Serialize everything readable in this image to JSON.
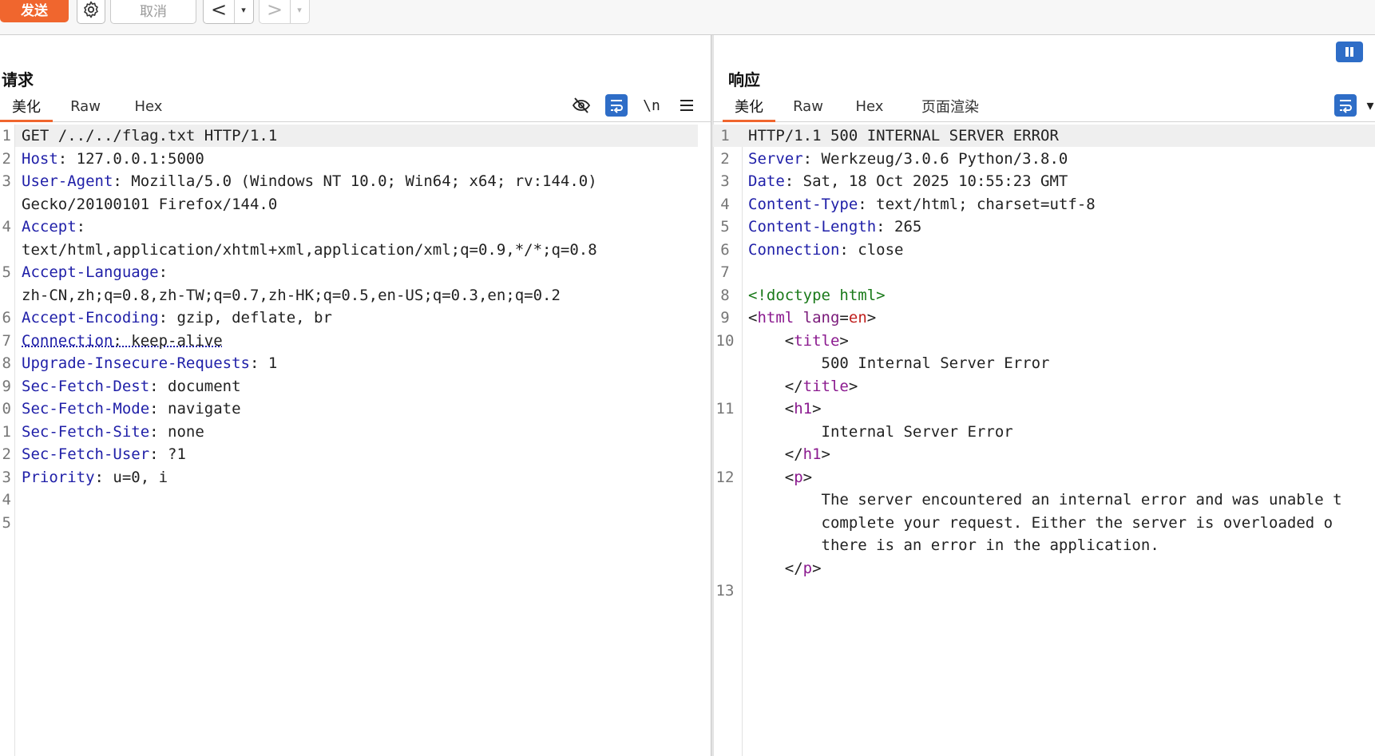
{
  "toolbar": {
    "send_label": "发送",
    "cancel_label": "取消",
    "back_arrow": "<",
    "forward_arrow": ">",
    "dropdown_arrow": "▾"
  },
  "request": {
    "title": "请求",
    "tabs": [
      "美化",
      "Raw",
      "Hex"
    ],
    "active_tab": "美化",
    "icons": [
      "hide-icon",
      "wrap-icon",
      "newline-icon",
      "menu-icon"
    ],
    "newline_label": "\\n",
    "lines": [
      {
        "n": "1",
        "key": "",
        "text": "GET /../../flag.txt HTTP/1.1"
      },
      {
        "n": "2",
        "key": "Host",
        "text": ": 127.0.0.1:5000"
      },
      {
        "n": "3",
        "key": "User-Agent",
        "text": ": Mozilla/5.0 (Windows NT 10.0; Win64; x64; rv:144.0)"
      },
      {
        "n": "",
        "key": "",
        "text": "Gecko/20100101 Firefox/144.0"
      },
      {
        "n": "4",
        "key": "Accept",
        "text": ":"
      },
      {
        "n": "",
        "key": "",
        "text": "text/html,application/xhtml+xml,application/xml;q=0.9,*/*;q=0.8"
      },
      {
        "n": "5",
        "key": "Accept-Language",
        "text": ":"
      },
      {
        "n": "",
        "key": "",
        "text": "zh-CN,zh;q=0.8,zh-TW;q=0.7,zh-HK;q=0.5,en-US;q=0.3,en;q=0.2"
      },
      {
        "n": "6",
        "key": "Accept-Encoding",
        "text": ": gzip, deflate, br"
      },
      {
        "n": "7",
        "key": "Connection",
        "text": ": keep-alive"
      },
      {
        "n": "8",
        "key": "Upgrade-Insecure-Requests",
        "text": ": 1"
      },
      {
        "n": "9",
        "key": "Sec-Fetch-Dest",
        "text": ": document"
      },
      {
        "n": "0",
        "key": "Sec-Fetch-Mode",
        "text": ": navigate"
      },
      {
        "n": "1",
        "key": "Sec-Fetch-Site",
        "text": ": none"
      },
      {
        "n": "2",
        "key": "Sec-Fetch-User",
        "text": ": ?1"
      },
      {
        "n": "3",
        "key": "Priority",
        "text": ": u=0, i"
      },
      {
        "n": "4",
        "key": "",
        "text": ""
      },
      {
        "n": "5",
        "key": "",
        "text": ""
      }
    ]
  },
  "response": {
    "title": "响应",
    "tabs": [
      "美化",
      "Raw",
      "Hex",
      "页面渲染"
    ],
    "active_tab": "美化",
    "lines": [
      {
        "n": "1",
        "parts": [
          {
            "c": "",
            "t": "HTTP/1.1 500 INTERNAL SERVER ERROR"
          }
        ]
      },
      {
        "n": "2",
        "parts": [
          {
            "c": "k",
            "t": "Server"
          },
          {
            "c": "",
            "t": ": Werkzeug/3.0.6 Python/3.8.0"
          }
        ]
      },
      {
        "n": "3",
        "parts": [
          {
            "c": "k",
            "t": "Date"
          },
          {
            "c": "",
            "t": ": Sat, 18 Oct 2025 10:55:23 GMT"
          }
        ]
      },
      {
        "n": "4",
        "parts": [
          {
            "c": "k",
            "t": "Content-Type"
          },
          {
            "c": "",
            "t": ": text/html; charset=utf-8"
          }
        ]
      },
      {
        "n": "5",
        "parts": [
          {
            "c": "k",
            "t": "Content-Length"
          },
          {
            "c": "",
            "t": ": 265"
          }
        ]
      },
      {
        "n": "6",
        "parts": [
          {
            "c": "k",
            "t": "Connection"
          },
          {
            "c": "",
            "t": ": close"
          }
        ]
      },
      {
        "n": "7",
        "parts": []
      },
      {
        "n": "8",
        "parts": [
          {
            "c": "tgd",
            "t": "<!doctype html>"
          }
        ]
      },
      {
        "n": "9",
        "parts": [
          {
            "c": "",
            "t": "<"
          },
          {
            "c": "tg",
            "t": "html"
          },
          {
            "c": "at",
            "t": " lang"
          },
          {
            "c": "",
            "t": "="
          },
          {
            "c": "av",
            "t": "en"
          },
          {
            "c": "",
            "t": ">"
          }
        ]
      },
      {
        "n": "10",
        "parts": [
          {
            "c": "",
            "t": "    <"
          },
          {
            "c": "tg",
            "t": "title"
          },
          {
            "c": "",
            "t": ">"
          }
        ]
      },
      {
        "n": "",
        "parts": [
          {
            "c": "",
            "t": "        500 Internal Server Error"
          }
        ]
      },
      {
        "n": "",
        "parts": [
          {
            "c": "",
            "t": "    </"
          },
          {
            "c": "tg",
            "t": "title"
          },
          {
            "c": "",
            "t": ">"
          }
        ]
      },
      {
        "n": "11",
        "parts": [
          {
            "c": "",
            "t": "    <"
          },
          {
            "c": "tg",
            "t": "h1"
          },
          {
            "c": "",
            "t": ">"
          }
        ]
      },
      {
        "n": "",
        "parts": [
          {
            "c": "",
            "t": "        Internal Server Error"
          }
        ]
      },
      {
        "n": "",
        "parts": [
          {
            "c": "",
            "t": "    </"
          },
          {
            "c": "tg",
            "t": "h1"
          },
          {
            "c": "",
            "t": ">"
          }
        ]
      },
      {
        "n": "12",
        "parts": [
          {
            "c": "",
            "t": "    <"
          },
          {
            "c": "tg",
            "t": "p"
          },
          {
            "c": "",
            "t": ">"
          }
        ]
      },
      {
        "n": "",
        "parts": [
          {
            "c": "",
            "t": "        The server encountered an internal error and was unable t"
          }
        ]
      },
      {
        "n": "",
        "parts": [
          {
            "c": "",
            "t": "        complete your request. Either the server is overloaded o"
          }
        ]
      },
      {
        "n": "",
        "parts": [
          {
            "c": "",
            "t": "        there is an error in the application."
          }
        ]
      },
      {
        "n": "",
        "parts": [
          {
            "c": "",
            "t": "    </"
          },
          {
            "c": "tg",
            "t": "p"
          },
          {
            "c": "",
            "t": ">"
          }
        ]
      },
      {
        "n": "13",
        "parts": []
      }
    ]
  },
  "colors": {
    "accent": "#f0662e",
    "icon_blue": "#2e6dc7",
    "header_key": "#1f1fa8",
    "html_tag": "#8b1a8f",
    "doctype": "#1a7a1a",
    "attr_value": "#c0201e"
  }
}
